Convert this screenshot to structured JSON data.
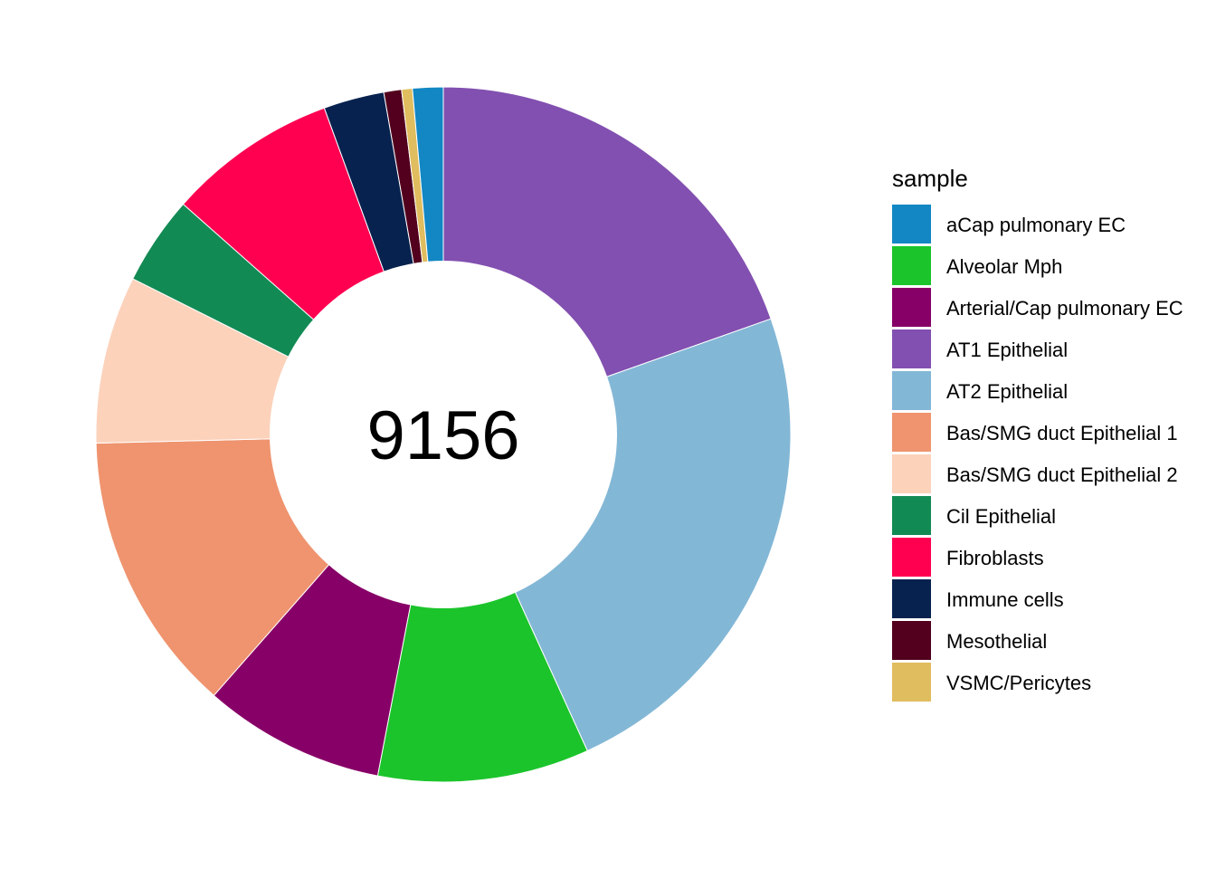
{
  "chart_data": {
    "type": "pie",
    "donut": true,
    "center_label": "9156",
    "legend": {
      "title": "sample",
      "position": "right"
    },
    "categories": [
      "aCap pulmonary EC",
      "Alveolar Mph",
      "Arterial/Cap pulmonary EC",
      "AT1 Epithelial",
      "AT2 Epithelial",
      "Bas/SMG duct Epithelial 1",
      "Bas/SMG duct Epithelial 2",
      "Cil Epithelial",
      "Fibroblasts",
      "Immune cells",
      "Mesothelial",
      "VSMC/Pericytes"
    ],
    "values": [
      131,
      906,
      779,
      1806,
      2174,
      1209,
      718,
      381,
      728,
      260,
      76,
      46
    ],
    "colors": [
      "#1287c3",
      "#1bc42b",
      "#870067",
      "#8250b0",
      "#83b7d6",
      "#ef946f",
      "#fcd2bb",
      "#128a54",
      "#ff0051",
      "#08224f",
      "#52001d",
      "#e0bd5e"
    ],
    "draw_order": [
      3,
      4,
      1,
      2,
      5,
      6,
      7,
      8,
      9,
      10,
      11,
      0
    ]
  }
}
